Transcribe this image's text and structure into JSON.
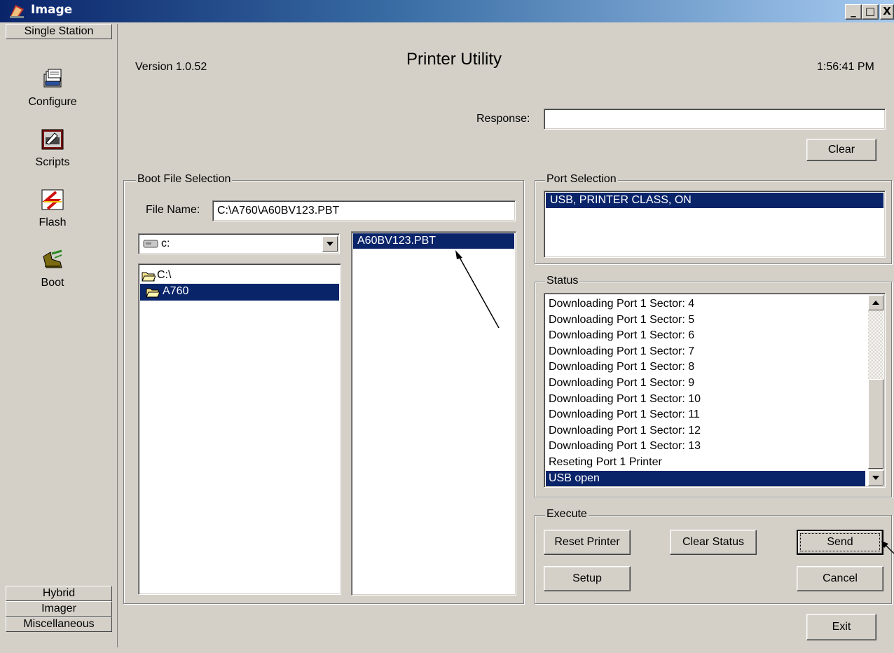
{
  "window": {
    "title": "Image",
    "minimize_glyph": "_",
    "maximize_glyph": "□",
    "close_glyph": "X",
    "icon": "app-icon"
  },
  "nav": {
    "top_tab": "Single Station",
    "items": [
      {
        "label": "Configure",
        "icon": "configure-icon"
      },
      {
        "label": "Scripts",
        "icon": "scripts-icon"
      },
      {
        "label": "Flash",
        "icon": "flash-icon"
      },
      {
        "label": "Boot",
        "icon": "boot-icon"
      }
    ],
    "bottom_tabs": [
      "Hybrid",
      "Imager",
      "Miscellaneous"
    ]
  },
  "header": {
    "version": "Version  1.0.52",
    "title": "Printer Utility",
    "time": "1:56:41 PM"
  },
  "response": {
    "label": "Response:",
    "value": "",
    "clear_label": "Clear"
  },
  "boot_file": {
    "group_label": "Boot File Selection",
    "file_name_label": "File Name:",
    "file_name_value": "C:\\A760\\A60BV123.PBT",
    "drive": "c:",
    "folders": [
      {
        "label": "C:\\",
        "selected": false
      },
      {
        "label": "A760",
        "selected": true
      }
    ],
    "files": [
      {
        "label": "A60BV123.PBT",
        "selected": true
      }
    ]
  },
  "port": {
    "group_label": "Port Selection",
    "items": [
      "USB, PRINTER CLASS, ON"
    ]
  },
  "status": {
    "group_label": "Status",
    "lines": [
      "Downloading Port 1 Sector: 4",
      "Downloading Port 1 Sector: 5",
      "Downloading Port 1 Sector: 6",
      "Downloading Port 1 Sector: 7",
      "Downloading Port 1 Sector: 8",
      "Downloading Port 1 Sector: 9",
      "Downloading Port 1 Sector: 10",
      "Downloading Port 1 Sector: 11",
      "Downloading Port 1 Sector: 12",
      "Downloading Port 1 Sector: 13",
      "Reseting Port 1 Printer",
      "USB open"
    ],
    "selected_index": 11
  },
  "execute": {
    "group_label": "Execute",
    "reset_printer": "Reset Printer",
    "clear_status": "Clear Status",
    "send": "Send",
    "setup": "Setup",
    "cancel": "Cancel"
  },
  "exit_label": "Exit",
  "colors": {
    "selection": "#0a246a",
    "face": "#d4d0c8"
  }
}
